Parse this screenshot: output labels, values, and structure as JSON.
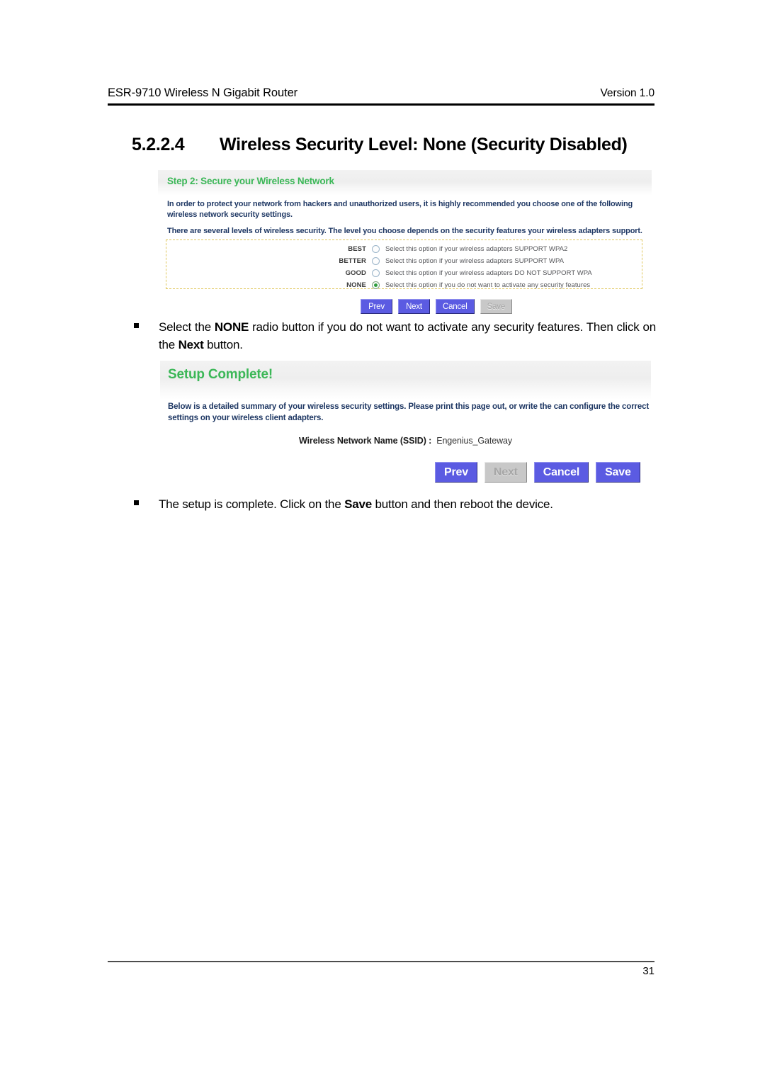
{
  "header": {
    "left": "ESR-9710 Wireless N Gigabit Router",
    "right": "Version 1.0"
  },
  "section": {
    "number": "5.2.2.4",
    "title": "Wireless Security Level: None (Security Disabled)"
  },
  "panel_step2": {
    "title": "Step 2: Secure your Wireless Network",
    "paragraph1": "In order to protect your network from hackers and unauthorized users, it is highly recommended you choose one of the following wireless network security settings.",
    "paragraph2": "There are several levels of wireless security. The level you choose depends on the security features your wireless adapters support.",
    "options": [
      {
        "label": "BEST",
        "description": "Select this option if your wireless adapters SUPPORT WPA2",
        "selected": false
      },
      {
        "label": "BETTER",
        "description": "Select this option if your wireless adapters SUPPORT WPA",
        "selected": false
      },
      {
        "label": "GOOD",
        "description": "Select this option if your wireless adapters DO NOT SUPPORT WPA",
        "selected": false
      },
      {
        "label": "NONE",
        "description": "Select this option if you do not want to activate any security features",
        "selected": true
      }
    ],
    "buttons": [
      {
        "label": "Prev",
        "disabled": false
      },
      {
        "label": "Next",
        "disabled": false
      },
      {
        "label": "Cancel",
        "disabled": false
      },
      {
        "label": "Save",
        "disabled": true
      }
    ]
  },
  "bullet_none": {
    "part1": "Select the ",
    "bold1": "NONE",
    "part2": " radio button if you do not want to activate any security features. Then click on the ",
    "bold2": "Next",
    "part3": " button."
  },
  "panel_complete": {
    "title": "Setup Complete!",
    "paragraph1": "Below is a detailed summary of your wireless security settings. Please print this page out, or write the can configure the correct settings on your wireless client adapters.",
    "ssid_label": "Wireless Network Name (SSID) :",
    "ssid_value": "Engenius_Gateway",
    "buttons": [
      {
        "label": "Prev",
        "disabled": false
      },
      {
        "label": "Next",
        "disabled": true
      },
      {
        "label": "Cancel",
        "disabled": false
      },
      {
        "label": "Save",
        "disabled": false
      }
    ]
  },
  "bullet_save": {
    "part1": "The setup is complete. Click on the ",
    "bold1": "Save",
    "part2": " button and then reboot the device."
  },
  "footer": {
    "page_number": "31"
  },
  "colors": {
    "panel_title_green": "#3bb757",
    "panel_text_blue": "#1f3864",
    "button_blue": "#5b5be2",
    "button_disabled_grey": "#c8c8c8",
    "options_border_yellow": "#e0c65a",
    "radio_selected_green": "#2f9e3f"
  }
}
